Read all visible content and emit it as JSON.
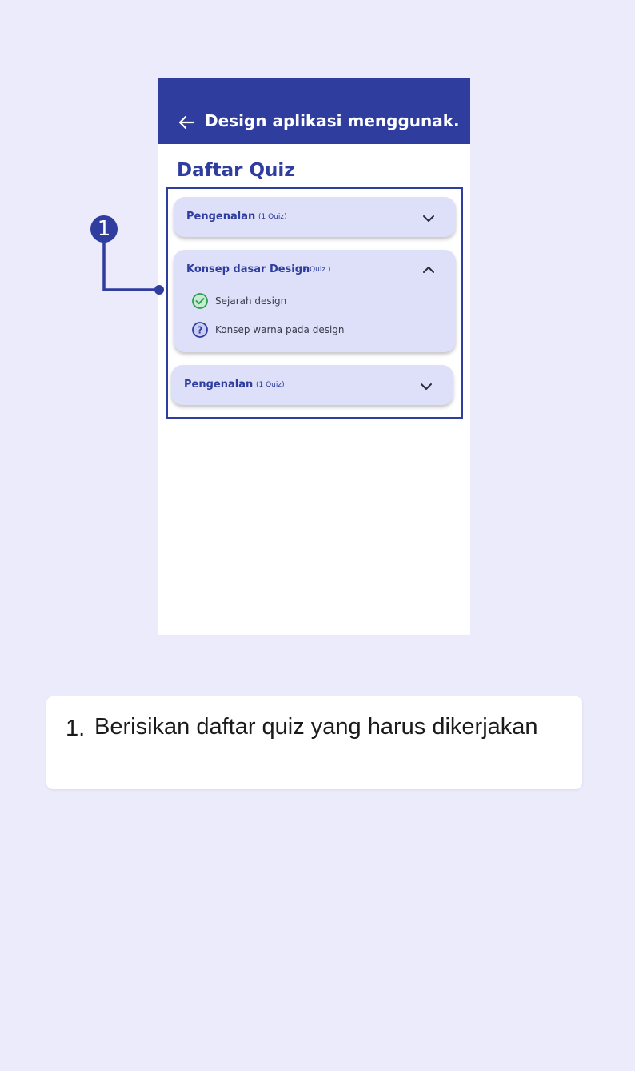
{
  "appbar": {
    "title": "Design aplikasi menggunak...",
    "back_icon": "arrow-left-icon"
  },
  "list_title": "Daftar Quiz",
  "sections": [
    {
      "title": "Pengenalan",
      "count": "(1 Quiz)",
      "expanded": false,
      "chevron_icon": "chevron-down-icon"
    },
    {
      "title": "Konsep dasar Design",
      "count": "(2 Quiz )",
      "expanded": true,
      "chevron_icon": "chevron-up-icon",
      "items": [
        {
          "label": "Sejarah design",
          "status": "completed",
          "icon": "check-circle-icon"
        },
        {
          "label": "Konsep warna pada design",
          "status": "pending",
          "icon": "question-circle-icon"
        }
      ]
    },
    {
      "title": "Pengenalan",
      "count": "(1 Quiz)",
      "expanded": false,
      "chevron_icon": "chevron-down-icon"
    }
  ],
  "callout": {
    "number": "1"
  },
  "note": {
    "number": "1.",
    "text": "Berisikan daftar quiz yang harus dikerjakan"
  },
  "colors": {
    "primary": "#2f3d9e",
    "background": "#ebebfb",
    "card": "#dde0f8",
    "success": "#2e9e4f"
  }
}
